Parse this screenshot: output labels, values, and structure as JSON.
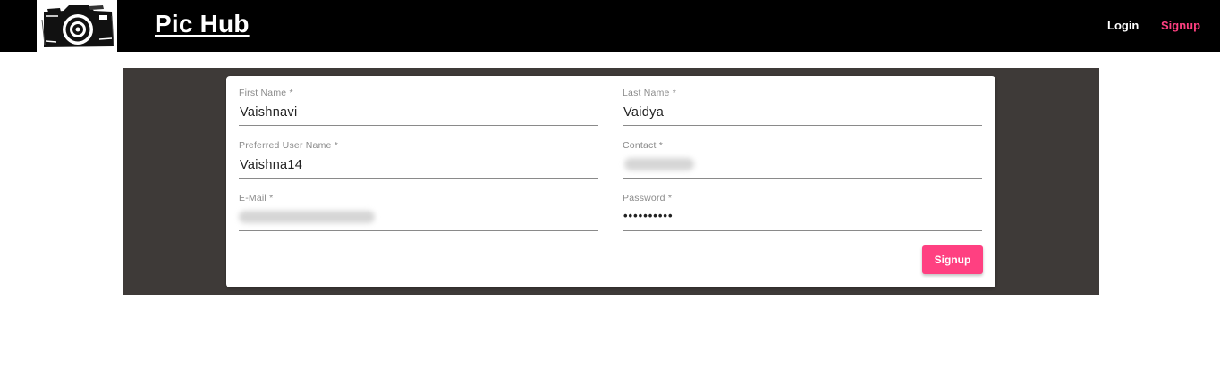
{
  "nav": {
    "brand": "Pic Hub",
    "logo_icon": "camera-icon",
    "login_label": "Login",
    "signup_label": "Signup",
    "signup_color": "#ff4081"
  },
  "form": {
    "first_name": {
      "label": "First Name *",
      "value": "Vaishnavi"
    },
    "last_name": {
      "label": "Last Name *",
      "value": "Vaidya"
    },
    "username": {
      "label": "Preferred User Name *",
      "value": "Vaishna14"
    },
    "contact": {
      "label": "Contact *",
      "value": ""
    },
    "email": {
      "label": "E-Mail *",
      "value": ""
    },
    "password": {
      "label": "Password *",
      "value": "••••••••••"
    },
    "submit_label": "Signup",
    "accent_color": "#ff4081",
    "panel_color": "#3e3a38"
  }
}
